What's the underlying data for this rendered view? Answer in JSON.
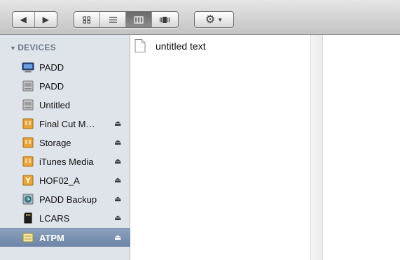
{
  "toolbar": {
    "back_icon": "back-arrow-icon",
    "forward_icon": "forward-arrow-icon",
    "view_buttons": [
      "icon-view",
      "list-view",
      "column-view",
      "cover-flow-view"
    ],
    "active_view": "column-view",
    "action_icon": "gear-icon"
  },
  "sidebar": {
    "section_title": "DEVICES",
    "devices": [
      {
        "label": "PADD",
        "icon": "display-icon",
        "eject": false,
        "selected": false
      },
      {
        "label": "PADD",
        "icon": "internal-disk-icon",
        "eject": false,
        "selected": false
      },
      {
        "label": "Untitled",
        "icon": "internal-disk-icon",
        "eject": false,
        "selected": false
      },
      {
        "label": "Final Cut M…",
        "icon": "external-disk-icon",
        "eject": true,
        "selected": false
      },
      {
        "label": "Storage",
        "icon": "external-disk-icon",
        "eject": true,
        "selected": false
      },
      {
        "label": "iTunes Media",
        "icon": "external-disk-icon",
        "eject": true,
        "selected": false
      },
      {
        "label": "HOF02_A",
        "icon": "external-disk-icon",
        "eject": true,
        "selected": false
      },
      {
        "label": "PADD Backup",
        "icon": "time-machine-disk-icon",
        "eject": true,
        "selected": false
      },
      {
        "label": "LCARS",
        "icon": "sd-card-icon",
        "eject": true,
        "selected": false
      },
      {
        "label": "ATPM",
        "icon": "disk-image-icon",
        "eject": true,
        "selected": true
      }
    ]
  },
  "content": {
    "files": [
      {
        "name": "untitled text",
        "icon": "text-document-icon"
      }
    ]
  },
  "colors": {
    "sidebar_bg": "#dee4ea",
    "section_title": "#6c7988",
    "selection": "#6c84a7",
    "external_disk": "#e9a53a"
  }
}
